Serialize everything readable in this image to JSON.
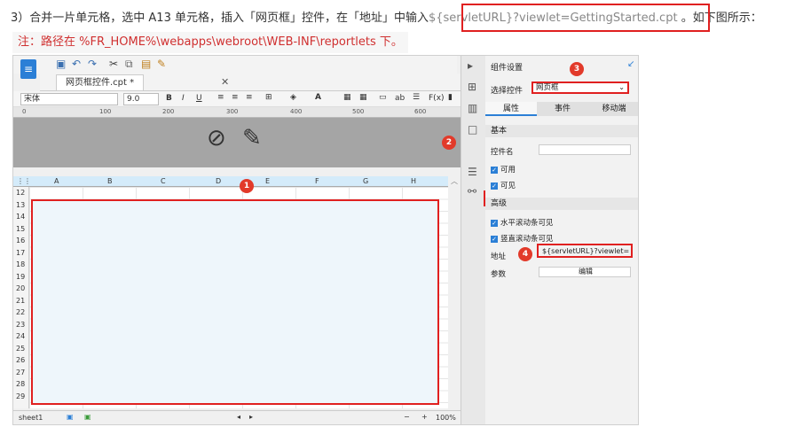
{
  "instruction": {
    "prefix": "3）合并一片单元格，选中 A13 单元格，插入「网页框」控件，在「地址」中输入",
    "code": "${servletURL}?viewlet=GettingStarted.cpt",
    "suffix": "。如下图所示："
  },
  "note": "注：路径在 %FR_HOME%\\webapps\\webroot\\WEB-INF\\reportlets 下。",
  "tab_label": "网页框控件.cpt *",
  "font_name": "宋体",
  "font_size": "9.0",
  "ruler_ticks": [
    "0",
    "100",
    "200",
    "300",
    "400",
    "500",
    "600"
  ],
  "columns": [
    "A",
    "B",
    "C",
    "D",
    "E",
    "F",
    "G",
    "H"
  ],
  "rows": [
    "12",
    "13",
    "14",
    "15",
    "16",
    "17",
    "18",
    "19",
    "20",
    "21",
    "22",
    "23",
    "24",
    "25",
    "26",
    "27",
    "28",
    "29"
  ],
  "sheet_tab": "sheet1",
  "zoom": "100%",
  "panel": {
    "title": "组件设置",
    "select_label": "选择控件",
    "select_value": "网页框",
    "tabs": [
      "属性",
      "事件",
      "移动端"
    ],
    "basic_section": "基本",
    "control_name_label": "控件名",
    "enabled_label": "可用",
    "visible_label": "可见",
    "advanced_section": "高级",
    "hscroll_label": "水平滚动条可见",
    "vscroll_label": "竖直滚动条可见",
    "address_label": "地址",
    "address_value": "${servletURL}?viewlet=G",
    "params_label": "参数",
    "edit_button": "编辑"
  },
  "badges": [
    "1",
    "2",
    "3",
    "4"
  ]
}
